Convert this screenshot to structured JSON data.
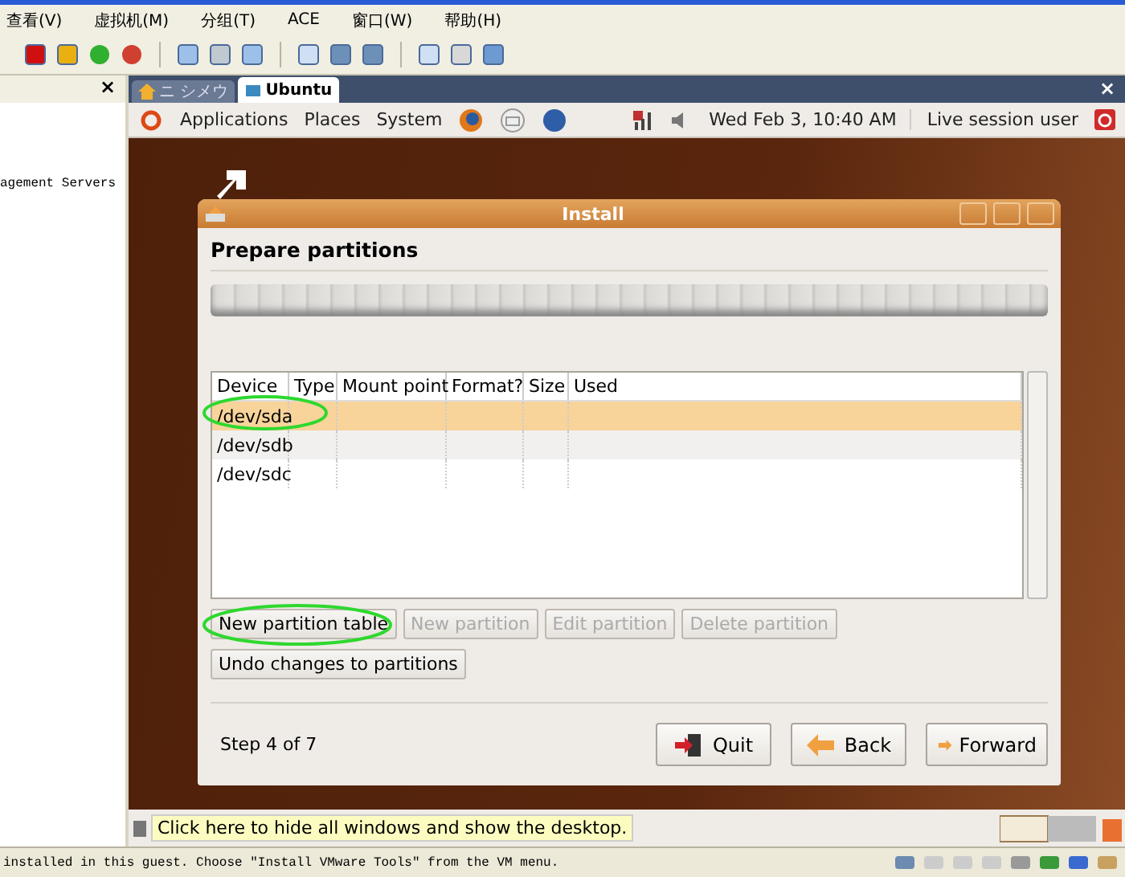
{
  "menubar": [
    "查看(V)",
    "虚拟机(M)",
    "分组(T)",
    "ACE",
    "窗口(W)",
    "帮助(H)"
  ],
  "sidebar": {
    "close": "×",
    "lines": [
      "agement Servers"
    ]
  },
  "vm_tabs": [
    {
      "label": "ニ シメウ",
      "selected": false,
      "kind": "home"
    },
    {
      "label": "Ubuntu",
      "selected": true,
      "kind": "vm"
    }
  ],
  "vm_tabs_close": "×",
  "top_panel": {
    "menus": [
      "Applications",
      "Places",
      "System"
    ],
    "clock": "Wed Feb  3, 10:40 AM",
    "user": "Live session user"
  },
  "dialog": {
    "title": "Install",
    "heading": "Prepare partitions",
    "table": {
      "columns": [
        "Device",
        "Type",
        "Mount point",
        "Format?",
        "Size",
        "Used"
      ],
      "rows": [
        {
          "device": "/dev/sda",
          "selected": true,
          "circled": true
        },
        {
          "device": "/dev/sdb",
          "selected": false,
          "circled": false
        },
        {
          "device": "/dev/sdc",
          "selected": false,
          "circled": false
        }
      ]
    },
    "partition_buttons": [
      {
        "label": "New partition table",
        "disabled": false,
        "circled": true
      },
      {
        "label": "New partition",
        "disabled": true,
        "circled": false
      },
      {
        "label": "Edit partition",
        "disabled": true,
        "circled": false
      },
      {
        "label": "Delete partition",
        "disabled": true,
        "circled": false
      }
    ],
    "undo_button": "Undo changes to partitions",
    "step": "Step 4 of 7",
    "nav_buttons": [
      {
        "kind": "quit",
        "label": "Quit"
      },
      {
        "kind": "back",
        "label": "Back"
      },
      {
        "kind": "forward",
        "label": "Forward"
      }
    ]
  },
  "bottom_panel": {
    "tooltip": "Click here to hide all windows and show the desktop."
  },
  "status_bar": {
    "message": "installed in this guest. Choose \"Install VMware Tools\" from the VM menu."
  }
}
